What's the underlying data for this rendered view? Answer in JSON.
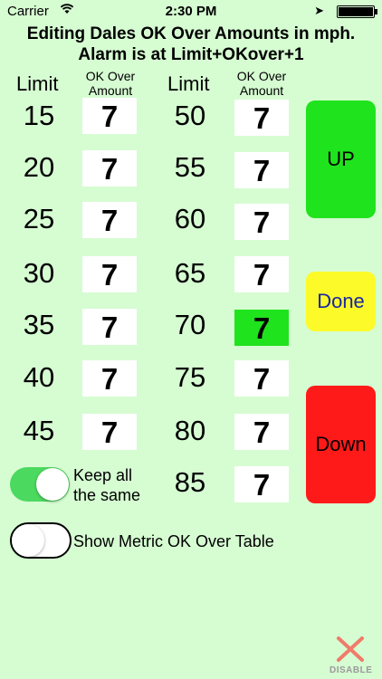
{
  "status": {
    "carrier": "Carrier",
    "time": "2:30 PM"
  },
  "title": {
    "line1": "Editing Dales OK Over Amounts in mph.",
    "line2": "Alarm is at Limit+OKover+1"
  },
  "headers": {
    "limit": "Limit",
    "ok_line1": "OK Over",
    "ok_line2": "Amount"
  },
  "rows_left": [
    {
      "limit": "15",
      "ok": "7"
    },
    {
      "limit": "20",
      "ok": "7"
    },
    {
      "limit": "25",
      "ok": "7"
    },
    {
      "limit": "30",
      "ok": "7"
    },
    {
      "limit": "35",
      "ok": "7"
    },
    {
      "limit": "40",
      "ok": "7"
    },
    {
      "limit": "45",
      "ok": "7"
    }
  ],
  "rows_right": [
    {
      "limit": "50",
      "ok": "7"
    },
    {
      "limit": "55",
      "ok": "7"
    },
    {
      "limit": "60",
      "ok": "7"
    },
    {
      "limit": "65",
      "ok": "7"
    },
    {
      "limit": "70",
      "ok": "7"
    },
    {
      "limit": "75",
      "ok": "7"
    },
    {
      "limit": "80",
      "ok": "7"
    },
    {
      "limit": "85",
      "ok": "7"
    }
  ],
  "selected": "70",
  "buttons": {
    "up": "UP",
    "done": "Done",
    "down": "Down"
  },
  "toggles": {
    "keep_same": {
      "line1": "Keep all",
      "line2": "the same",
      "on": true
    },
    "metric": {
      "label": "Show Metric OK Over Table",
      "on": false
    }
  },
  "disable": {
    "label": "DISABLE",
    "icon": "close-x-icon"
  },
  "colors": {
    "background": "#d6fcd2",
    "up": "#1fe31c",
    "done": "#fdfa29",
    "down": "#ff1a1a",
    "selected": "#1fe31c"
  }
}
